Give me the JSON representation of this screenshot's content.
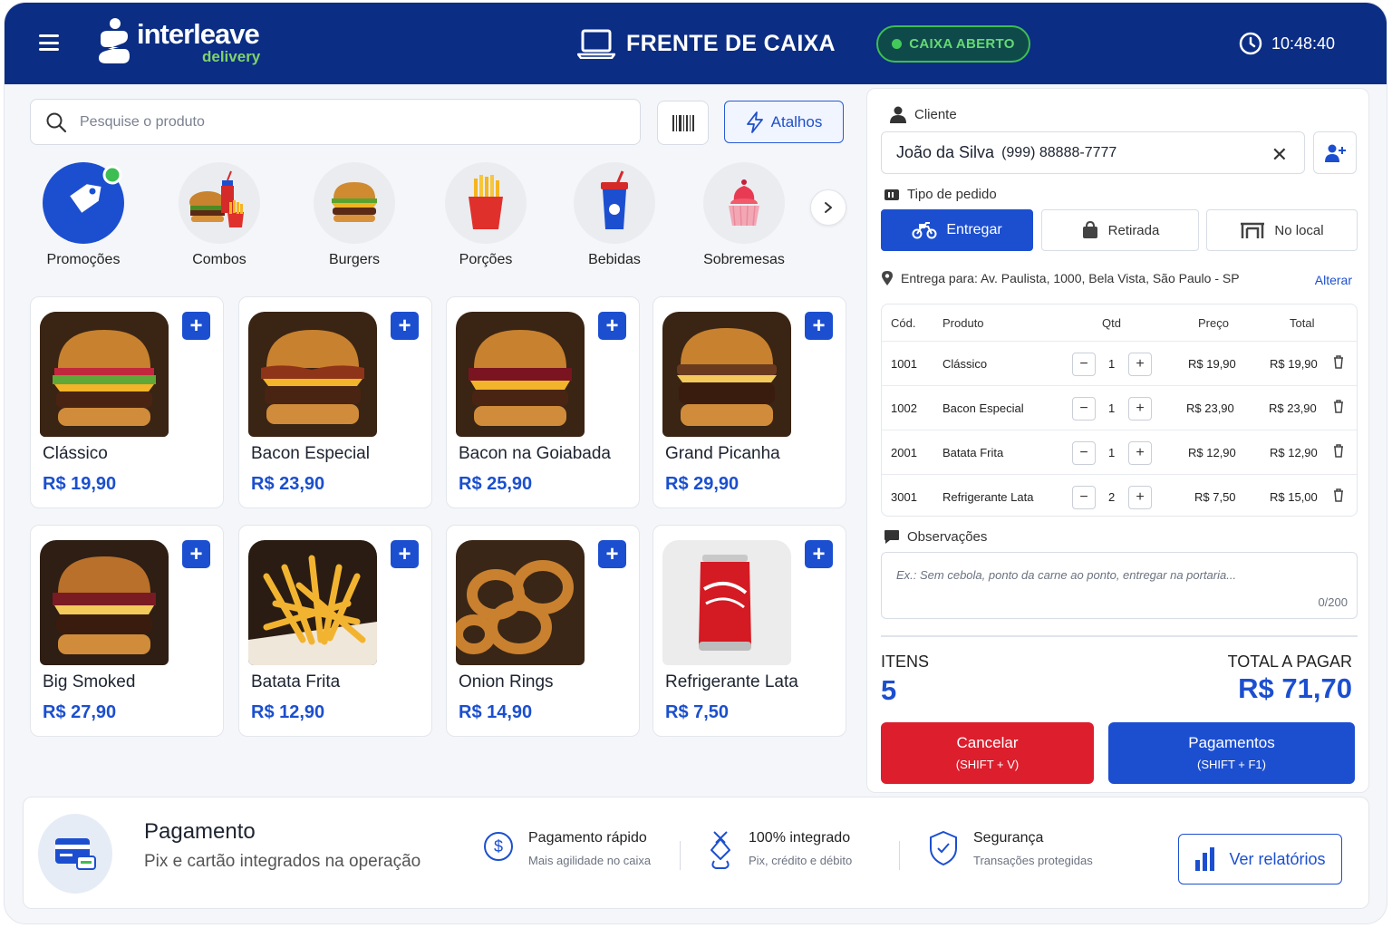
{
  "header": {
    "brand_name": "interleave",
    "brand_sub": "delivery",
    "title": "FRENTE DE CAIXA",
    "status": "CAIXA ABERTO",
    "time": "10:48:40",
    "brand_color": "#0b2d84",
    "status_color": "#43c95a"
  },
  "search": {
    "placeholder": "Pesquise o produto"
  },
  "toolbar": {
    "shortcuts_label": "Atalhos"
  },
  "categories": [
    {
      "label": "Promoções",
      "icon": "tag-icon"
    },
    {
      "label": "Combos",
      "icon": "combo-icon"
    },
    {
      "label": "Burgers",
      "icon": "burger-icon"
    },
    {
      "label": "Porções",
      "icon": "fries-icon"
    },
    {
      "label": "Bebidas",
      "icon": "drink-icon"
    },
    {
      "label": "Sobremesas",
      "icon": "dessert-icon"
    }
  ],
  "products": [
    {
      "name": "Clássico",
      "price": "R$ 19,90"
    },
    {
      "name": "Bacon Especial",
      "price": "R$ 23,90"
    },
    {
      "name": "Bacon na Goiabada",
      "price": "R$ 25,90"
    },
    {
      "name": "Grand Picanha",
      "price": "R$ 29,90"
    },
    {
      "name": "Big Smoked",
      "price": "R$ 27,90"
    },
    {
      "name": "Batata Frita",
      "price": "R$ 12,90"
    },
    {
      "name": "Onion Rings",
      "price": "R$ 14,90"
    },
    {
      "name": "Refrigerante Lata",
      "price": "R$ 7,50"
    }
  ],
  "order": {
    "client_label": "Cliente",
    "client_name": "João da Silva",
    "client_phone": "(999) 88888-7777",
    "type_label": "Tipo de pedido",
    "types": [
      "Entregar",
      "Retirada",
      "No local"
    ],
    "delivery_address": "Entrega para: Av. Paulista, 1000, Bela Vista, São Paulo - SP",
    "change_label": "Alterar",
    "columns": [
      "Cód.",
      "Produto",
      "Qtd",
      "Preço",
      "Total"
    ],
    "items": [
      {
        "code": "1001",
        "product": "Clássico",
        "qty": "1",
        "price": "R$ 19,90",
        "total": "R$ 19,90"
      },
      {
        "code": "1002",
        "product": "Bacon Especial",
        "qty": "1",
        "price": "R$ 23,90",
        "total": "R$ 23,90"
      },
      {
        "code": "2001",
        "product": "Batata Frita",
        "qty": "1",
        "price": "R$ 12,90",
        "total": "R$ 12,90"
      },
      {
        "code": "3001",
        "product": "Refrigerante Lata",
        "qty": "2",
        "price": "R$ 7,50",
        "total": "R$ 15,00"
      }
    ],
    "notes_label": "Observações",
    "notes_placeholder": "Ex.: Sem cebola, ponto da carne ao ponto, entregar na portaria...",
    "notes_count": "0/200",
    "items_label": "ITENS",
    "items_count": "5",
    "total_label": "TOTAL A PAGAR",
    "total_value": "R$ 71,70",
    "cancel_label": "Cancelar",
    "cancel_shortcut": "(SHIFT + V)",
    "pay_label": "Pagamentos",
    "pay_shortcut": "(SHIFT + F1)",
    "cancel_color": "#dc1e2d",
    "pay_color": "#1c4fd0"
  },
  "footer": {
    "title": "Pagamento",
    "subtitle": "Pix e cartão integrados na operação",
    "features": [
      {
        "title": "Pagamento rápido",
        "subtitle": "Mais agilidade no caixa",
        "icon": "dollar-icon"
      },
      {
        "title": "100% integrado",
        "subtitle": "Pix, crédito e débito",
        "icon": "pix-icon"
      },
      {
        "title": "Segurança",
        "subtitle": "Transações protegidas",
        "icon": "shield-check-icon"
      }
    ],
    "reports_label": "Ver relatórios"
  }
}
